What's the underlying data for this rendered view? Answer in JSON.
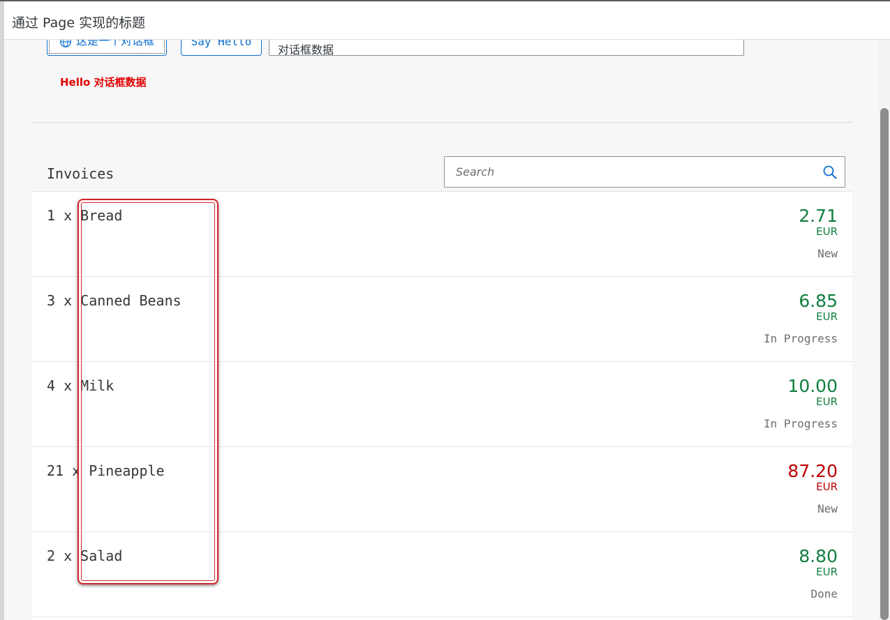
{
  "header": {
    "title": "通过 Page 实现的标题"
  },
  "toolbar": {
    "dialog_button_label": "这是一个对话框",
    "dialog_button_icon": "globe-icon",
    "say_hello_label": "Say Hello",
    "name_input_value": "对话框数据"
  },
  "hello_message": "Hello 对话框数据",
  "invoices": {
    "title": "Invoices",
    "search_placeholder": "Search",
    "search_icon": "search-icon",
    "items": [
      {
        "quantity": "1 x",
        "product": "Bread",
        "amount": "2.71",
        "currency": "EUR",
        "status": "New",
        "state": "positive"
      },
      {
        "quantity": "3 x",
        "product": "Canned Beans",
        "amount": "6.85",
        "currency": "EUR",
        "status": "In Progress",
        "state": "positive"
      },
      {
        "quantity": "4 x",
        "product": "Milk",
        "amount": "10.00",
        "currency": "EUR",
        "status": "In Progress",
        "state": "positive"
      },
      {
        "quantity": "21 x",
        "product": "Pineapple",
        "amount": "87.20",
        "currency": "EUR",
        "status": "New",
        "state": "negative"
      },
      {
        "quantity": "2 x",
        "product": "Salad",
        "amount": "8.80",
        "currency": "EUR",
        "status": "Done",
        "state": "positive"
      }
    ]
  },
  "colors": {
    "accent": "#0a6ed1",
    "positive": "#107e3e",
    "negative": "#bb0000",
    "hello_text": "#e00000",
    "highlight": "#d2232a"
  }
}
